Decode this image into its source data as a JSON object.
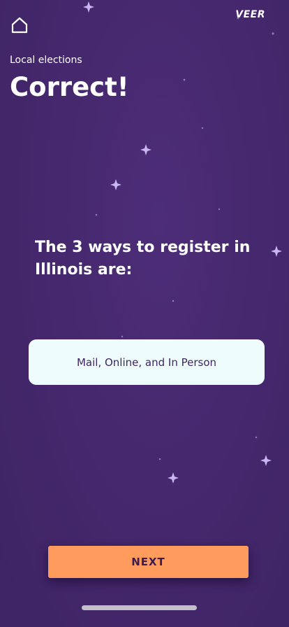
{
  "header": {
    "home_icon": "home-icon",
    "logo_text": "VEER"
  },
  "page": {
    "subtitle": "Local elections",
    "title": "Correct!"
  },
  "question": {
    "text": "The 3 ways to register in Illinois are:"
  },
  "answer": {
    "text": "Mail, Online, and In Person"
  },
  "actions": {
    "next_label": "NEXT"
  },
  "colors": {
    "background": "#44276c",
    "answer_card": "#eefdfb",
    "next_button": "#ff9b5c",
    "text_dark": "#3e2565"
  }
}
